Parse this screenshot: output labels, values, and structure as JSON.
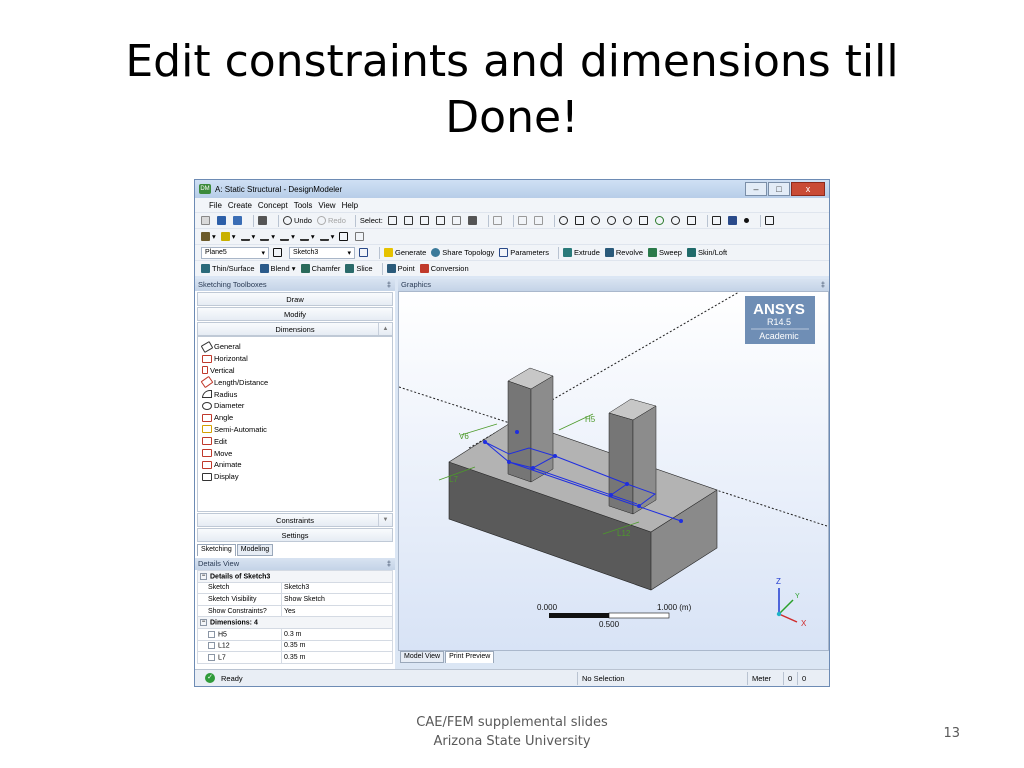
{
  "slide": {
    "title_line1": "Edit constraints and dimensions till",
    "title_line2": "Done!",
    "footer_line1": "CAE/FEM supplemental slides",
    "footer_line2": "Arizona State University",
    "page_number": "13"
  },
  "window": {
    "title": "A: Static Structural - DesignModeler",
    "minimize": "–",
    "maximize": "□",
    "close": "x"
  },
  "menu": [
    "File",
    "Create",
    "Concept",
    "Tools",
    "View",
    "Help"
  ],
  "toolbar1": {
    "undo": "Undo",
    "redo": "Redo",
    "select": "Select:"
  },
  "toolbar3": {
    "plane": "Plane5",
    "sketch": "Sketch3",
    "generate": "Generate",
    "share_topology": "Share Topology",
    "parameters": "Parameters",
    "extrude": "Extrude",
    "revolve": "Revolve",
    "sweep": "Sweep",
    "skin_loft": "Skin/Loft"
  },
  "toolbar4": {
    "thin_surface": "Thin/Surface",
    "blend": "Blend",
    "chamfer": "Chamfer",
    "slice": "Slice",
    "point": "Point",
    "conversion": "Conversion"
  },
  "sketching_toolboxes": {
    "header": "Sketching Toolboxes",
    "pin": "‡",
    "draw": "Draw",
    "modify": "Modify",
    "dimensions": "Dimensions",
    "items": [
      "General",
      "Horizontal",
      "Vertical",
      "Length/Distance",
      "Radius",
      "Diameter",
      "Angle",
      "Semi-Automatic",
      "Edit",
      "Move",
      "Animate",
      "Display"
    ],
    "constraints": "Constraints",
    "settings": "Settings",
    "tab_sketching": "Sketching",
    "tab_modeling": "Modeling"
  },
  "details": {
    "header": "Details View",
    "pin": "‡",
    "section_title": "Details of Sketch3",
    "rows": [
      {
        "label": "Sketch",
        "value": "Sketch3"
      },
      {
        "label": "Sketch Visibility",
        "value": "Show Sketch"
      },
      {
        "label": "Show Constraints?",
        "value": "Yes"
      }
    ],
    "dimensions_title": "Dimensions: 4",
    "dimensions": [
      {
        "label": "H5",
        "value": "0.3 m"
      },
      {
        "label": "L12",
        "value": "0.35 m"
      },
      {
        "label": "L7",
        "value": "0.35 m"
      }
    ]
  },
  "graphics": {
    "header": "Graphics",
    "brand": "ANSYS",
    "version": "R14.5",
    "edition": "Academic",
    "dim_labels": [
      "V6",
      "H5",
      "L7",
      "L12"
    ],
    "scale_start": "0.000",
    "scale_end": "1.000 (m)",
    "scale_mid": "0.500",
    "axis_z": "Z",
    "axis_x": "X",
    "axis_y": "Y",
    "tab_model": "Model View",
    "tab_print": "Print Preview"
  },
  "status": {
    "ready": "Ready",
    "selection": "No Selection",
    "units": "Meter",
    "val1": "0",
    "val2": "0"
  },
  "colors": {
    "brand_bg": "#6f8eb5",
    "solid_light": "#b3b3b3",
    "solid_dark": "#5a5a5a",
    "sketch_line": "#1f2ee0",
    "dim_green": "#4c9a2a"
  }
}
